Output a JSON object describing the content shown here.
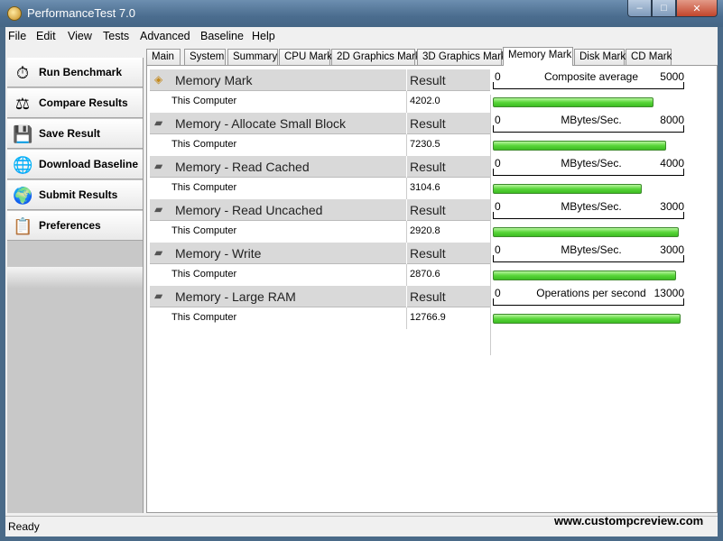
{
  "window": {
    "title": "PerformanceTest 7.0",
    "minimize": "‒",
    "maximize": "□",
    "close": "✕"
  },
  "menu": [
    "File",
    "Edit",
    "View",
    "Tests",
    "Advanced",
    "Baseline",
    "Help"
  ],
  "sidebar": [
    {
      "label": "Run Benchmark",
      "icon": "stopwatch-icon",
      "glyph": "⏱"
    },
    {
      "label": "Compare Results",
      "icon": "scales-icon",
      "glyph": "⚖"
    },
    {
      "label": "Save Result",
      "icon": "floppy-disk-icon",
      "glyph": "💾"
    },
    {
      "label": "Download Baseline",
      "icon": "globe-download-icon",
      "glyph": "🌐"
    },
    {
      "label": "Submit Results",
      "icon": "globe-upload-icon",
      "glyph": "🌍"
    },
    {
      "label": "Preferences",
      "icon": "clipboard-icon",
      "glyph": "📋"
    }
  ],
  "tabs": [
    "Main",
    "System",
    "Summary",
    "CPU Mark",
    "2D Graphics Mark",
    "3D Graphics Mark",
    "Memory Mark",
    "Disk Mark",
    "CD Mark"
  ],
  "active_tab": "Memory Mark",
  "result_header": "Result",
  "computer_label": "This Computer",
  "rows": [
    {
      "name": "Memory Mark",
      "icon": "memory-mark-icon",
      "value": "4202.0",
      "scale_min": "0",
      "scale_unit": "Composite average",
      "scale_max": "5000",
      "fraction": 0.8404
    },
    {
      "name": "Memory - Allocate Small Block",
      "icon": "memory-chip-icon",
      "value": "7230.5",
      "scale_min": "0",
      "scale_unit": "MBytes/Sec.",
      "scale_max": "8000",
      "fraction": 0.9038
    },
    {
      "name": "Memory - Read Cached",
      "icon": "memory-chip-icon",
      "value": "3104.6",
      "scale_min": "0",
      "scale_unit": "MBytes/Sec.",
      "scale_max": "4000",
      "fraction": 0.7762
    },
    {
      "name": "Memory - Read Uncached",
      "icon": "memory-chip-icon",
      "value": "2920.8",
      "scale_min": "0",
      "scale_unit": "MBytes/Sec.",
      "scale_max": "3000",
      "fraction": 0.9736
    },
    {
      "name": "Memory - Write",
      "icon": "memory-chip-icon",
      "value": "2870.6",
      "scale_min": "0",
      "scale_unit": "MBytes/Sec.",
      "scale_max": "3000",
      "fraction": 0.9569
    },
    {
      "name": "Memory - Large RAM",
      "icon": "memory-chip-icon",
      "value": "12766.9",
      "scale_min": "0",
      "scale_unit": "Operations per second",
      "scale_max": "13000",
      "fraction": 0.9821
    }
  ],
  "status": {
    "text": "Ready",
    "watermark": "www.custompcreview.com"
  },
  "colors": {
    "bar": "#59d63a",
    "titlebar": "#4b6d8f"
  }
}
